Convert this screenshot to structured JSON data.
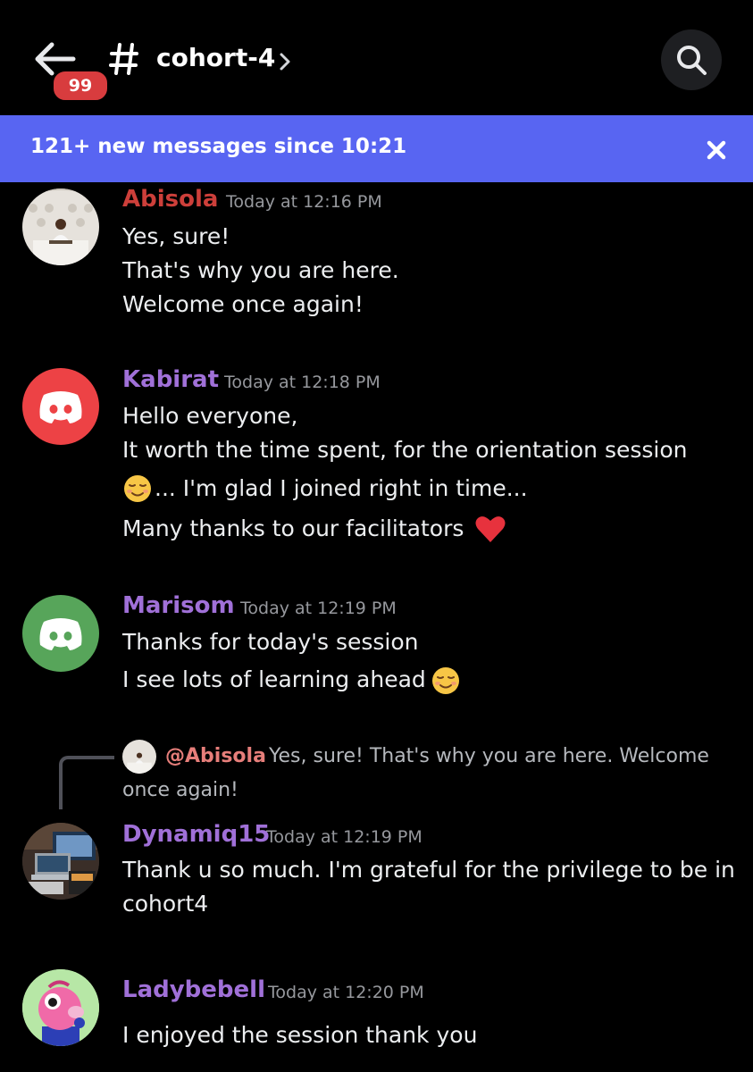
{
  "header": {
    "unread_badge": "99",
    "channel_name": "cohort-4",
    "icons": [
      "back-arrow-icon",
      "hash-icon",
      "chevron-right-icon",
      "search-icon"
    ]
  },
  "banner": {
    "text": "121+ new messages since 10:21",
    "close_icon": "close-icon"
  },
  "colors": {
    "banner": "#5865f2",
    "badge": "#d83c3e",
    "abisola": "#cd3f3a",
    "member": "#a070d8",
    "mention": "#e67e7a"
  },
  "messages": [
    {
      "author": "Abisola",
      "timestamp": "Today at 12:16 PM",
      "lines": [
        "Yes, sure!",
        "That's why you are here.",
        "Welcome once again!"
      ]
    },
    {
      "author": "Kabirat",
      "timestamp": "Today at 12:18 PM",
      "lines": [
        "Hello everyone,",
        "It worth the time spent, for the orientation session",
        "... I'm glad I joined right in time...",
        "Many thanks to our facilitators"
      ]
    },
    {
      "author": "Marisom",
      "timestamp": "Today at 12:19 PM",
      "lines": [
        "Thanks for today's session",
        "I see lots of learning ahead"
      ]
    },
    {
      "author": "Dynamiq15",
      "timestamp": "Today at 12:19 PM",
      "reply": {
        "mention": "@Abisola",
        "text_line1": "Yes, sure! That's why you are here. Welcome",
        "text_line2": "once again!"
      },
      "lines": [
        "Thank u so much. I'm grateful for the privilege to be in",
        "cohort4"
      ]
    },
    {
      "author": "Ladybebell",
      "timestamp": "Today at 12:20 PM",
      "lines": [
        "I enjoyed the session thank you"
      ]
    }
  ]
}
